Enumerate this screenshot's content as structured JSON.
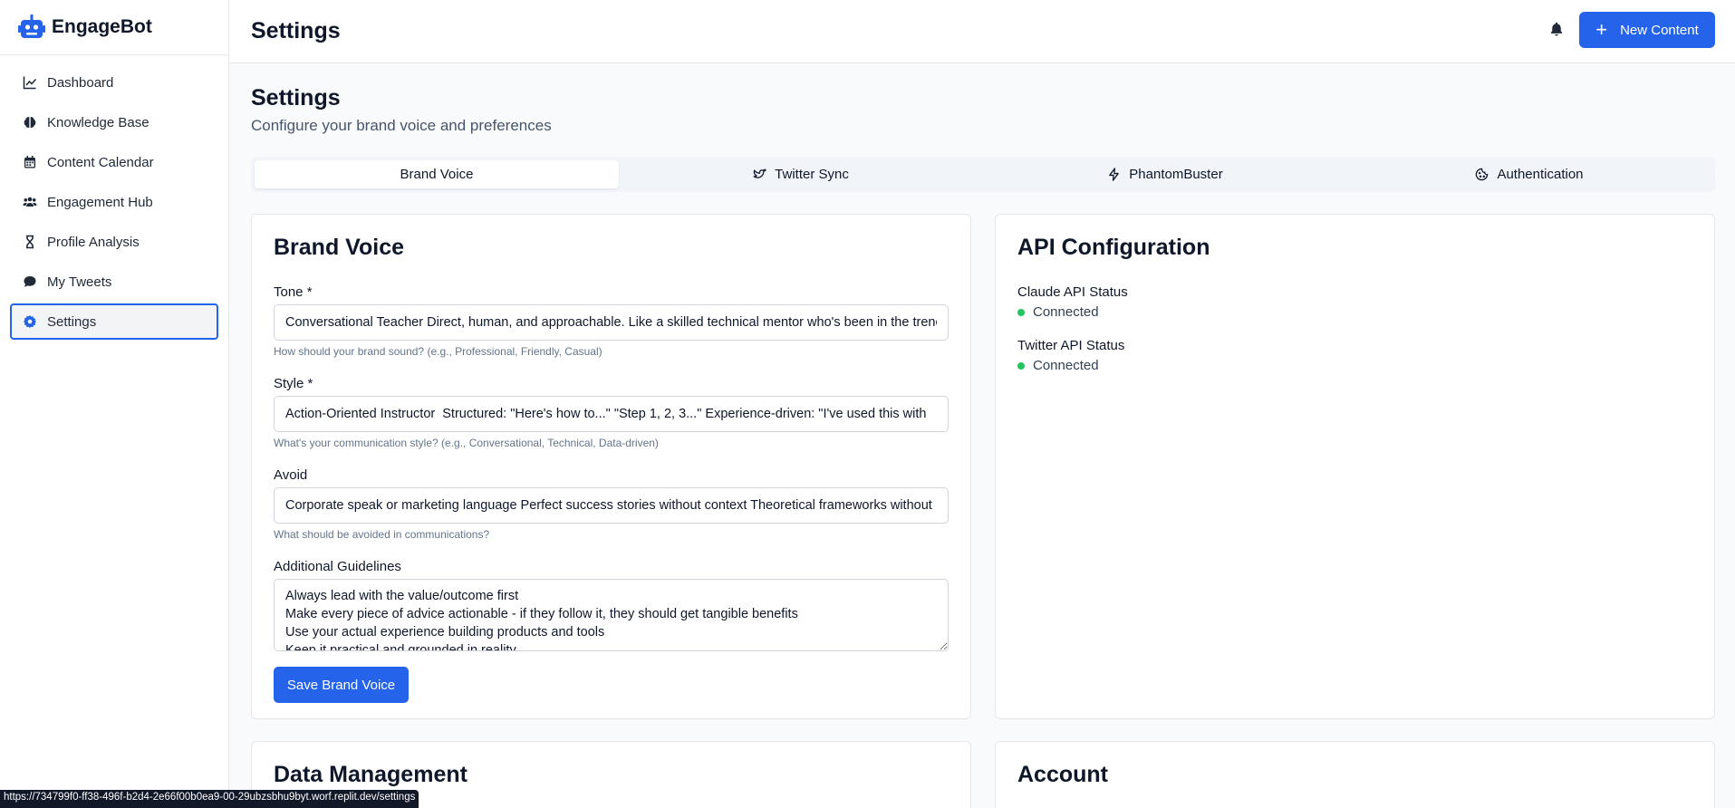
{
  "app": {
    "name": "EngageBot"
  },
  "sidebar": {
    "items": [
      {
        "label": "Dashboard",
        "icon": "chart-line-icon"
      },
      {
        "label": "Knowledge Base",
        "icon": "brain-icon"
      },
      {
        "label": "Content Calendar",
        "icon": "calendar-icon"
      },
      {
        "label": "Engagement Hub",
        "icon": "users-icon"
      },
      {
        "label": "Profile Analysis",
        "icon": "hourglass-icon"
      },
      {
        "label": "My Tweets",
        "icon": "comment-icon"
      },
      {
        "label": "Settings",
        "icon": "gear-icon",
        "active": true
      }
    ]
  },
  "header": {
    "title": "Settings",
    "new_content_label": "New Content"
  },
  "page": {
    "title": "Settings",
    "subtitle": "Configure your brand voice and preferences"
  },
  "tabs": [
    {
      "label": "Brand Voice",
      "active": true
    },
    {
      "label": "Twitter Sync",
      "icon": "twitter-icon"
    },
    {
      "label": "PhantomBuster",
      "icon": "bolt-icon"
    },
    {
      "label": "Authentication",
      "icon": "cookie-icon"
    }
  ],
  "brand_voice": {
    "title": "Brand Voice",
    "tone_label": "Tone *",
    "tone_value": "Conversational Teacher Direct, human, and approachable. Like a skilled technical mentor who's been in the trenches",
    "tone_hint": "How should your brand sound? (e.g., Professional, Friendly, Casual)",
    "style_label": "Style *",
    "style_value": "Action-Oriented Instructor  Structured: \"Here's how to...\" \"Step 1, 2, 3...\" Experience-driven: \"I've used this with",
    "style_hint": "What's your communication style? (e.g., Conversational, Technical, Data-driven)",
    "avoid_label": "Avoid",
    "avoid_value": "Corporate speak or marketing language Perfect success stories without context Theoretical frameworks without",
    "avoid_hint": "What should be avoided in communications?",
    "guidelines_label": "Additional Guidelines",
    "guidelines_value": "Always lead with the value/outcome first\nMake every piece of advice actionable - if they follow it, they should get tangible benefits\nUse your actual experience building products and tools\nKeep it practical and grounded in reality",
    "save_label": "Save Brand Voice"
  },
  "api_config": {
    "title": "API Configuration",
    "claude_label": "Claude API Status",
    "claude_status": "Connected",
    "twitter_label": "Twitter API Status",
    "twitter_status": "Connected"
  },
  "data_management": {
    "title": "Data Management"
  },
  "account": {
    "title": "Account"
  },
  "status_url": "https://734799f0-ff38-496f-b2d4-2e66f00b0ea9-00-29ubzsbhu9byt.worf.replit.dev/settings",
  "colors": {
    "accent": "#2563eb",
    "status_connected": "#22c55e"
  }
}
